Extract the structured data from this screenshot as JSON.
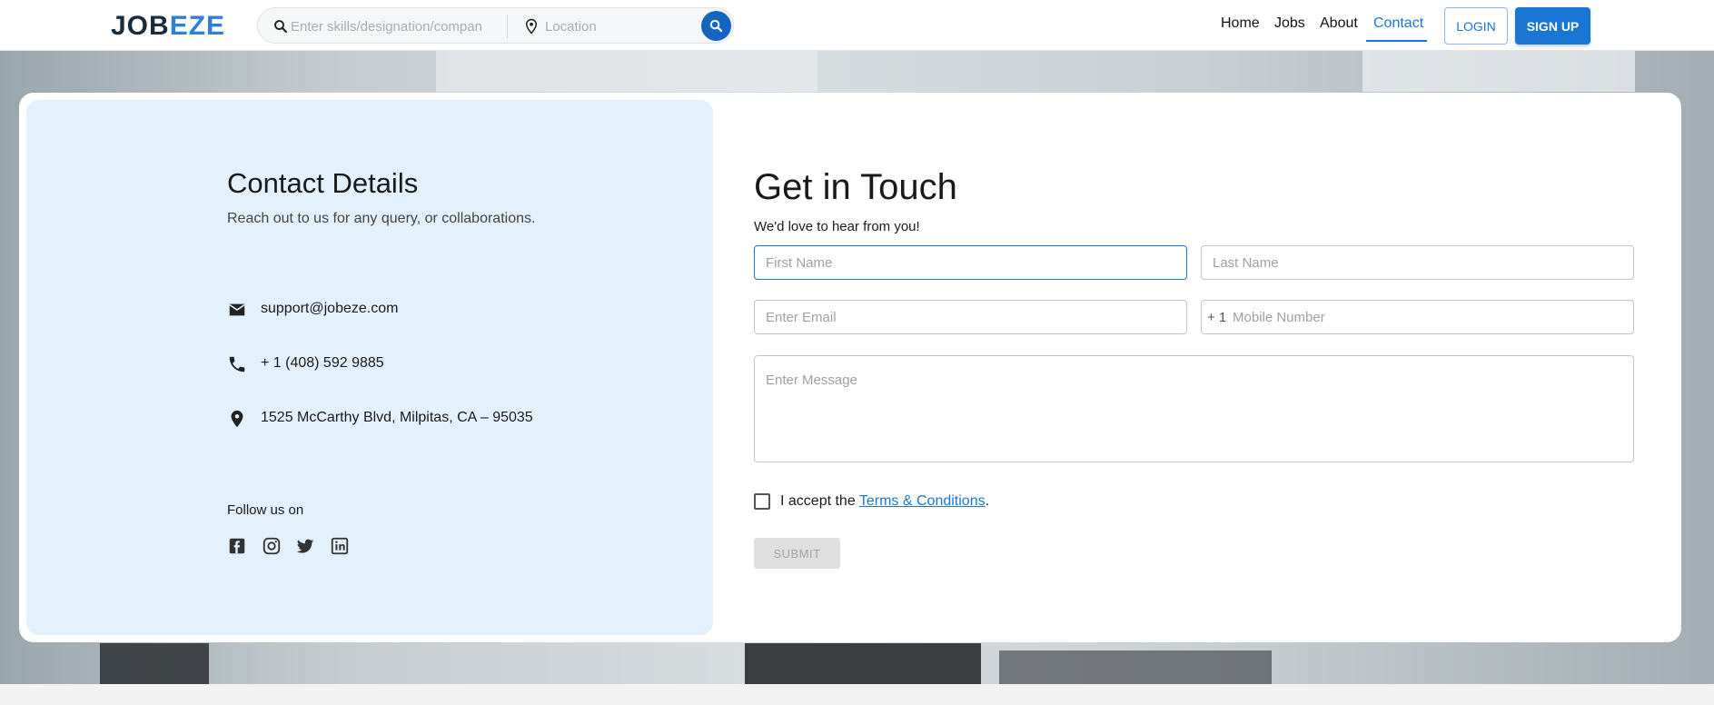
{
  "header": {
    "logo_part1": "JOB",
    "logo_part2": "EZE",
    "search_placeholder": "Enter skills/designation/company",
    "location_placeholder": "Location",
    "nav": [
      "Home",
      "Jobs",
      "About",
      "Contact"
    ],
    "active_nav": "Contact",
    "login_label": "LOGIN",
    "signup_label": "SIGN UP"
  },
  "contact_details": {
    "title": "Contact Details",
    "subtitle": "Reach out to us for any query, or collaborations.",
    "email": "support@jobeze.com",
    "phone": "+ 1 (408) 592 9885",
    "address": "1525 McCarthy Blvd, Milpitas, CA – 95035",
    "follow_label": "Follow us on",
    "social_icons": [
      "facebook-icon",
      "instagram-icon",
      "twitter-icon",
      "linkedin-icon"
    ]
  },
  "form": {
    "title": "Get in Touch",
    "subtitle": "We'd love to hear from you!",
    "first_name_placeholder": "First Name",
    "last_name_placeholder": "Last Name",
    "email_placeholder": "Enter Email",
    "country_code": "+ 1",
    "mobile_placeholder": "Mobile Number",
    "message_placeholder": "Enter Message",
    "accept_prefix": "I accept the ",
    "terms_link": "Terms & Conditions",
    "accept_suffix": ".",
    "submit_label": "SUBMIT"
  },
  "colors": {
    "brand_dark": "#1a2b3c",
    "brand_accent": "#2f7fd8",
    "primary": "#1976d2",
    "panel_bg": "#e3f1fd"
  }
}
